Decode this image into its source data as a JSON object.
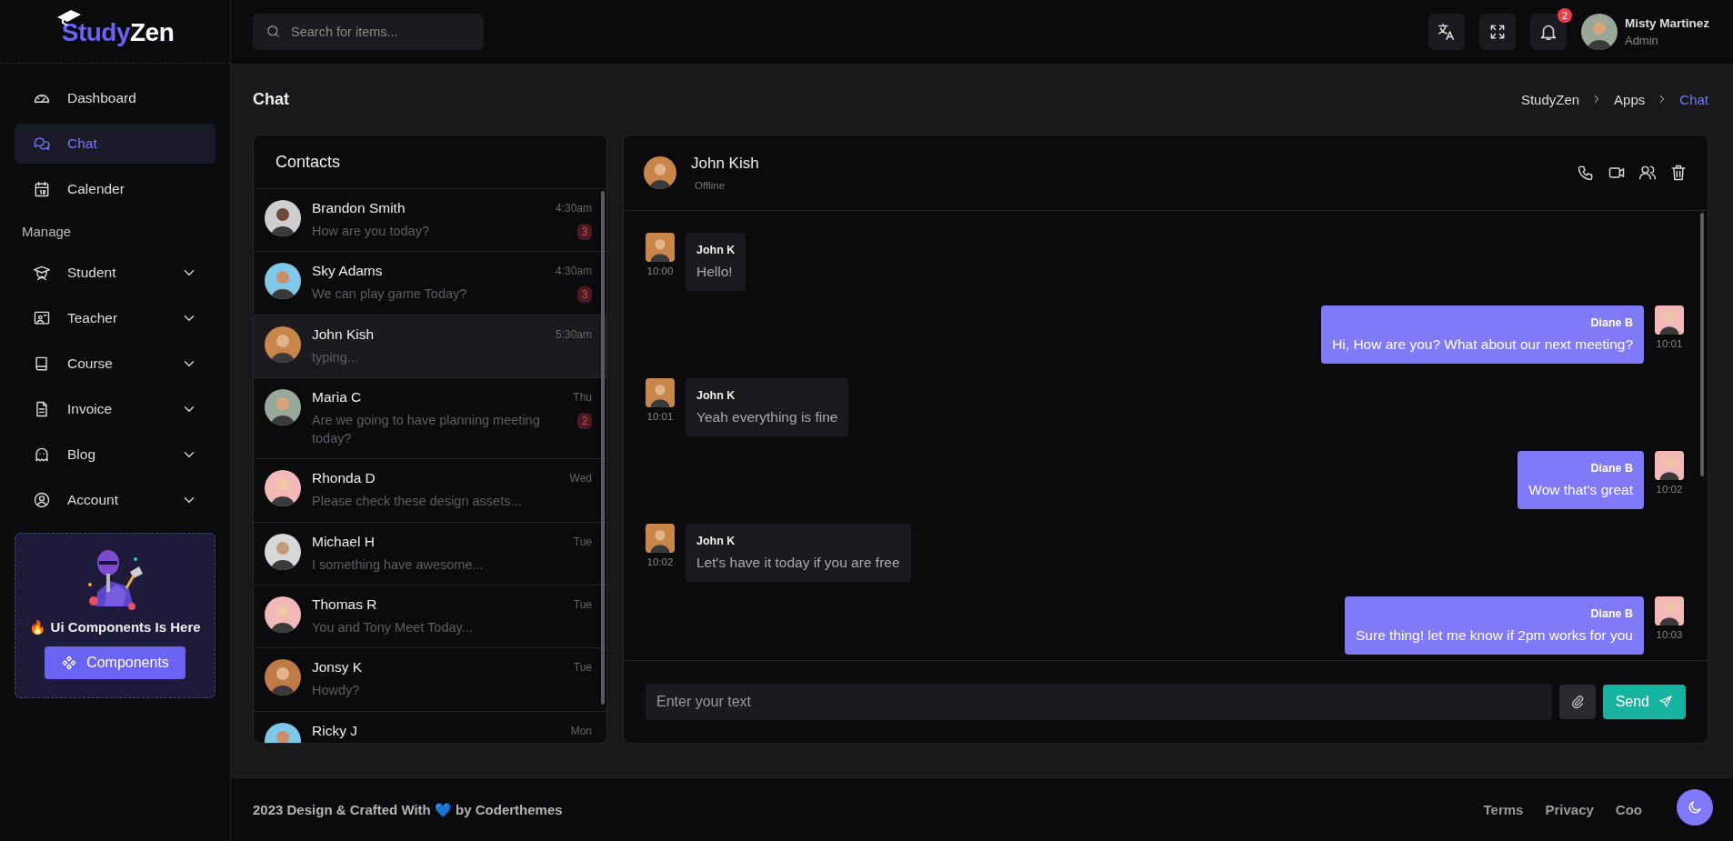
{
  "logo": {
    "first": "Study",
    "second": "Zen"
  },
  "sidebar": {
    "items": [
      {
        "kind": "link",
        "label": "Dashboard",
        "selected": false
      },
      {
        "kind": "link",
        "label": "Chat",
        "selected": true
      },
      {
        "kind": "link",
        "label": "Calender",
        "selected": false
      },
      {
        "kind": "section",
        "label": "Manage"
      },
      {
        "kind": "menu",
        "label": "Student",
        "expanded": false
      },
      {
        "kind": "menu",
        "label": "Teacher",
        "expanded": false
      },
      {
        "kind": "menu",
        "label": "Course",
        "expanded": false
      },
      {
        "kind": "menu",
        "label": "Invoice",
        "expanded": false
      },
      {
        "kind": "menu",
        "label": "Blog",
        "expanded": false
      },
      {
        "kind": "menu",
        "label": "Account",
        "expanded": false
      }
    ],
    "promo": {
      "title": "🔥 Ui Components Is Here",
      "button": "Components"
    }
  },
  "topbar": {
    "search": {
      "placeholder": "Search for items..."
    },
    "notifications": "2",
    "user": {
      "name": "Misty Martinez",
      "role": "Admin"
    }
  },
  "page": {
    "title": "Chat",
    "breadcrumb": [
      {
        "label": "StudyZen",
        "selected": false
      },
      {
        "label": "Apps",
        "selected": false
      },
      {
        "label": "Chat",
        "selected": true
      }
    ]
  },
  "contacts": {
    "title": "Contacts",
    "items": [
      {
        "name": "Brandon Smith",
        "preview": "How are you today?",
        "time": "4:30am",
        "unread": "3",
        "selected": false
      },
      {
        "name": "Sky Adams",
        "preview": "We can play game Today?",
        "time": "4:30am",
        "unread": "3",
        "selected": false
      },
      {
        "name": "John Kish",
        "preview": "typing...",
        "time": "5:30am",
        "selected": true
      },
      {
        "name": "Maria C",
        "preview": "Are we going to have planning meeting today?",
        "time": "Thu",
        "unread": "2",
        "selected": false
      },
      {
        "name": "Rhonda D",
        "preview": "Please check these design assets...",
        "time": "Wed",
        "selected": false
      },
      {
        "name": "Michael H",
        "preview": "I something have awesome...",
        "time": "Tue",
        "selected": false
      },
      {
        "name": "Thomas R",
        "preview": "You and Tony Meet Today...",
        "time": "Tue",
        "selected": false
      },
      {
        "name": "Jonsy K",
        "preview": "Howdy?",
        "time": "Tue",
        "selected": false
      },
      {
        "name": "Ricky J",
        "time": "Mon",
        "selected": false
      }
    ]
  },
  "chat": {
    "name": "John Kish",
    "status": "Offline",
    "messages": [
      {
        "kind": "incoming",
        "sender": "John K",
        "text": "Hello!",
        "time": "10:00"
      },
      {
        "kind": "outgoing",
        "sender": "Diane B",
        "text": "Hi, How are you? What about our next meeting?",
        "time": "10:01"
      },
      {
        "kind": "incoming",
        "sender": "John K",
        "text": "Yeah everything is fine",
        "time": "10:01"
      },
      {
        "kind": "outgoing",
        "sender": "Diane B",
        "text": "Wow that's great",
        "time": "10:02"
      },
      {
        "kind": "incoming",
        "sender": "John K",
        "text": "Let's have it today if you are free",
        "time": "10:02"
      },
      {
        "kind": "outgoing",
        "sender": "Diane B",
        "text": "Sure thing! let me know if 2pm works for you",
        "time": "10:03"
      }
    ],
    "input": {
      "placeholder": "Enter your text"
    },
    "send": "Send"
  },
  "footer": {
    "credit": "2023 Design & Crafted With 💙 by Coderthemes",
    "links": [
      "Terms",
      "Privacy",
      "Coo"
    ]
  }
}
